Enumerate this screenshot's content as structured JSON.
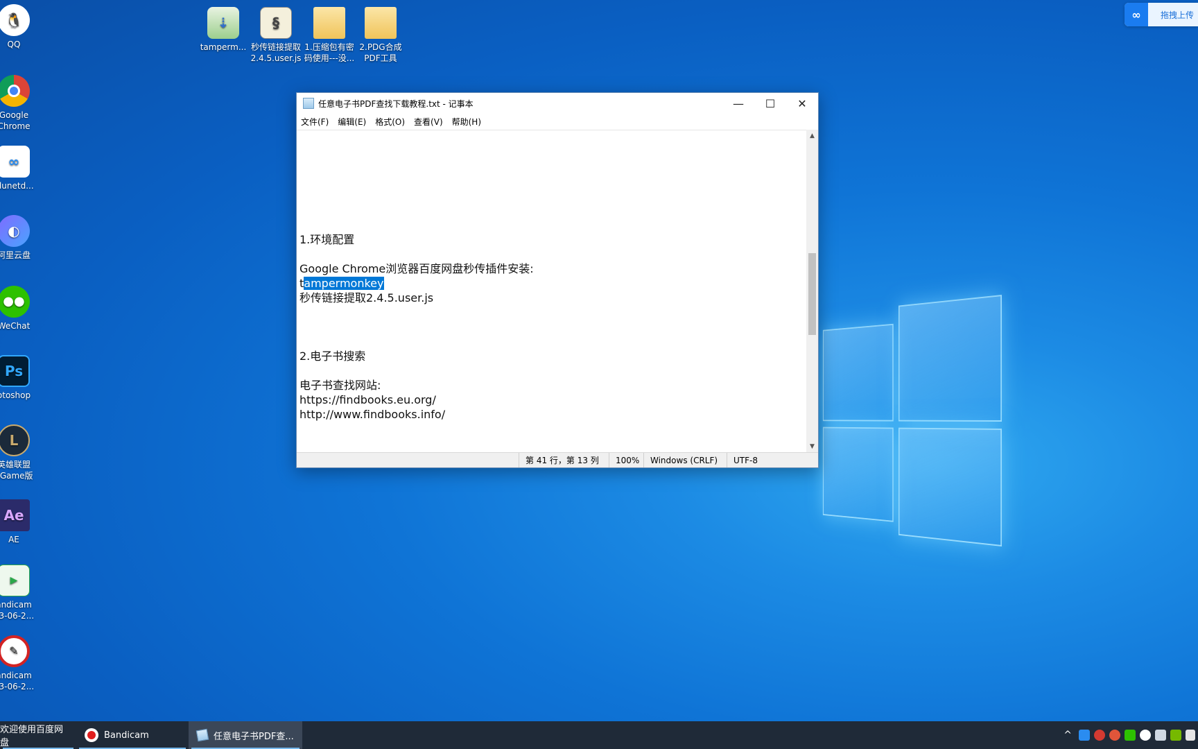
{
  "desktop": {
    "left_icons": [
      {
        "label": "QQ",
        "icon": "qq-penguin-icon",
        "color": "#111111"
      },
      {
        "label": "Google\nChrome",
        "icon": "chrome-icon",
        "color": "#db4437"
      },
      {
        "label": "idunetd...",
        "icon": "baidunetdisk-icon",
        "color": "#ffffff"
      },
      {
        "label": "阿里云盘",
        "icon": "aliyun-drive-icon",
        "color": "#6a5bff"
      },
      {
        "label": "WeChat",
        "icon": "wechat-icon",
        "color": "#2dc100"
      },
      {
        "label": "otoshop",
        "icon": "photoshop-icon",
        "color": "#001d34"
      },
      {
        "label": "英雄联盟\neGame版",
        "icon": "league-of-legends-icon",
        "color": "#1b2a3a"
      },
      {
        "label": "AE",
        "icon": "after-effects-icon",
        "color": "#1a1a4a"
      },
      {
        "label": "andicam\n23-06-2...",
        "icon": "mp4-file-icon",
        "color": "#eef8ee"
      },
      {
        "label": "andicam\n23-06-2...",
        "icon": "bandicam-icon",
        "color": "#ffffff"
      }
    ],
    "top_icons": [
      {
        "label": "tamperm...",
        "icon": "tampermonkey-installer-icon",
        "color": "#4fa35a"
      },
      {
        "label": "秒传链接提取\n2.4.5.user.js",
        "icon": "script-file-icon",
        "color": "#f4f0dc"
      },
      {
        "label": "1.压缩包有密\n码使用---没...",
        "icon": "folder-icon",
        "color": "#f6d27a"
      },
      {
        "label": "2.PDG合成\nPDF工具",
        "icon": "folder-icon",
        "color": "#f6d27a"
      }
    ],
    "upload_label": "拖拽上传"
  },
  "notepad": {
    "title": "任意电子书PDF查找下载教程.txt - 记事本",
    "controls": {
      "minimize": "—",
      "maximize": "☐",
      "close": "✕"
    },
    "menu": [
      "文件(F)",
      "编辑(E)",
      "格式(O)",
      "查看(V)",
      "帮助(H)"
    ],
    "lines": {
      "l1": "1.环境配置",
      "l2": "Google Chrome浏览器百度网盘秒传插件安装:",
      "l3_pre": "t",
      "l3_sel": "ampermonkey",
      "l4": "秒传链接提取2.4.5.user.js",
      "l5": "2.电子书搜索",
      "l6": "电子书查找网站:",
      "l7": "https://findbooks.eu.org/",
      "l8": "http://www.findbooks.info/"
    },
    "status": {
      "position": "第 41 行，第 13 列",
      "zoom": "100%",
      "line_ending": "Windows (CRLF)",
      "encoding": "UTF-8"
    }
  },
  "taskbar": {
    "items": [
      {
        "label": "欢迎使用百度网盘",
        "active": false
      },
      {
        "label": "Bandicam",
        "active": false
      },
      {
        "label": "任意电子书PDF查...",
        "active": true
      }
    ],
    "tray_chevron": "^"
  }
}
